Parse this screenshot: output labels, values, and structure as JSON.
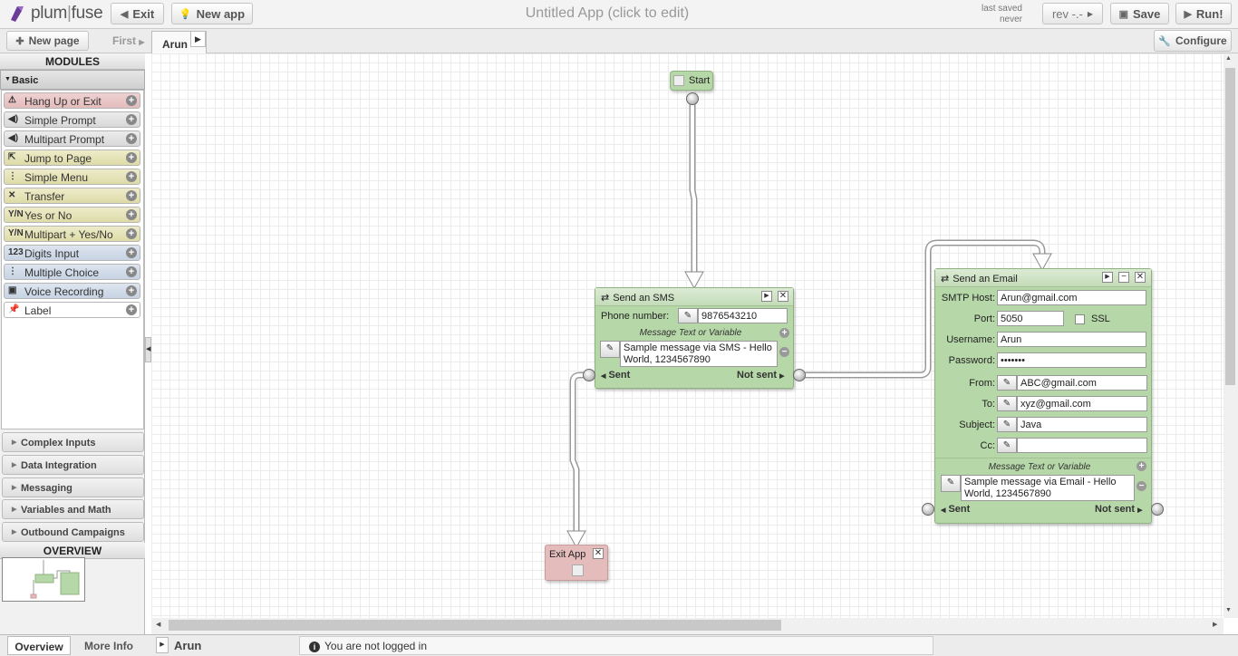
{
  "header": {
    "logo_left": "plum",
    "logo_right": "fuse",
    "exit_label": "Exit",
    "new_app_label": "New app",
    "app_title": "Untitled App (click to edit)",
    "last_saved_label": "last saved",
    "last_saved_value": "never",
    "rev_label": "rev -.-",
    "save_label": "Save",
    "run_label": "Run!"
  },
  "pagebar": {
    "new_page_label": "New page",
    "first_label": "First",
    "current_tab": "Arun",
    "configure_label": "Configure"
  },
  "sidebar": {
    "modules_title": "MODULES",
    "basic_label": "Basic",
    "modules": [
      {
        "label": "Hang Up or Exit",
        "icon": "warning-icon"
      },
      {
        "label": "Simple Prompt",
        "icon": "speaker-icon"
      },
      {
        "label": "Multipart Prompt",
        "icon": "speaker-icon"
      },
      {
        "label": "Jump to Page",
        "icon": "jump-icon"
      },
      {
        "label": "Simple Menu",
        "icon": "menu-tree-icon"
      },
      {
        "label": "Transfer",
        "icon": "transfer-icon"
      },
      {
        "label": "Yes or No",
        "icon": "yes-no-icon"
      },
      {
        "label": "Multipart + Yes/No",
        "icon": "yes-no-icon"
      },
      {
        "label": "Digits Input",
        "icon": "digits-icon"
      },
      {
        "label": "Multiple Choice",
        "icon": "menu-tree-icon"
      },
      {
        "label": "Voice Recording",
        "icon": "tape-icon"
      },
      {
        "label": "Label",
        "icon": "pin-icon"
      }
    ],
    "categories": [
      "Complex Inputs",
      "Data Integration",
      "Messaging",
      "Variables and Math",
      "Outbound Campaigns"
    ],
    "overview_title": "OVERVIEW"
  },
  "nodes": {
    "start": {
      "label": "Start"
    },
    "sms": {
      "title": "Send an SMS",
      "phone_label": "Phone number:",
      "phone_value": "9876543210",
      "message_header": "Message Text or Variable",
      "message_value": "Sample message via SMS - Hello World, 1234567890",
      "sent_label": "Sent",
      "not_sent_label": "Not sent"
    },
    "email": {
      "title": "Send an Email",
      "smtp_label": "SMTP Host:",
      "smtp_value": "Arun@gmail.com",
      "port_label": "Port:",
      "port_value": "5050",
      "ssl_label": "SSL",
      "username_label": "Username:",
      "username_value": "Arun",
      "password_label": "Password:",
      "password_value": "•••••••",
      "from_label": "From:",
      "from_value": "ABC@gmail.com",
      "to_label": "To:",
      "to_value": "xyz@gmail.com",
      "subject_label": "Subject:",
      "subject_value": "Java",
      "cc_label": "Cc:",
      "cc_value": "",
      "message_header": "Message Text or Variable",
      "message_value": "Sample message via Email - Hello World, 1234567890",
      "sent_label": "Sent",
      "not_sent_label": "Not sent"
    },
    "exit": {
      "title": "Exit App"
    }
  },
  "footer": {
    "overview_tab": "Overview",
    "more_info_tab": "More Info",
    "page_name": "Arun",
    "status_text": "You are not logged in"
  }
}
